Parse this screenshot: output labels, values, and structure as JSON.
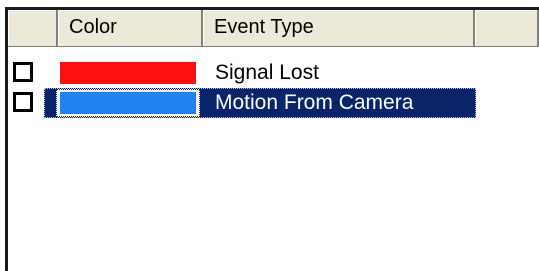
{
  "columns": {
    "check": "",
    "color": "Color",
    "event_type": "Event Type",
    "rest": ""
  },
  "rows": [
    {
      "checked": false,
      "color": "#ff1010",
      "event_type": "Signal Lost",
      "selected": false
    },
    {
      "checked": false,
      "color": "#1e82f0",
      "event_type": "Motion From Camera",
      "selected": true
    }
  ],
  "colors": {
    "selection_background": "#0a246a",
    "header_background": "#ece9d8"
  }
}
